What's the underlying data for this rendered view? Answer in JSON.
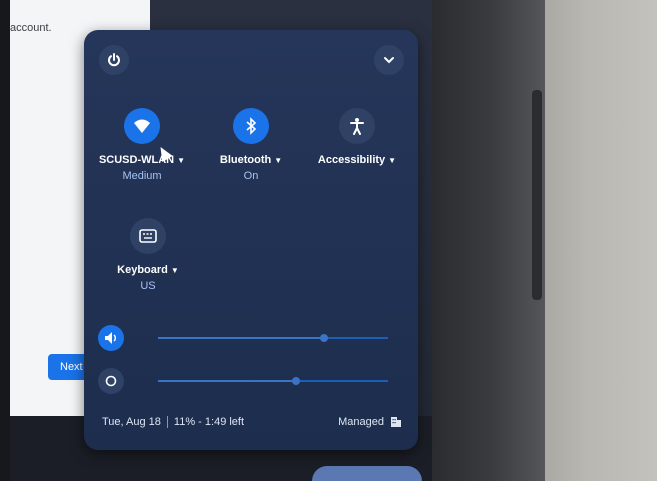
{
  "background": {
    "account_text": "account.",
    "next_label": "Next"
  },
  "quick_settings": {
    "features": [
      {
        "label": "SCUSD-WLAN",
        "sublabel": "Medium",
        "icon": "wifi-icon",
        "active": true
      },
      {
        "label": "Bluetooth",
        "sublabel": "On",
        "icon": "bluetooth-icon",
        "active": true
      },
      {
        "label": "Accessibility",
        "sublabel": "",
        "icon": "accessibility-icon",
        "active": false
      },
      {
        "label": "Keyboard",
        "sublabel": "US",
        "icon": "keyboard-icon",
        "active": false
      }
    ],
    "volume_level": 0.72,
    "brightness_level": 0.6,
    "footer": {
      "date": "Tue, Aug 18",
      "battery": "11% - 1:49 left",
      "managed_label": "Managed"
    }
  },
  "colors": {
    "accent": "#1a73e8",
    "panel": "#22335a"
  }
}
